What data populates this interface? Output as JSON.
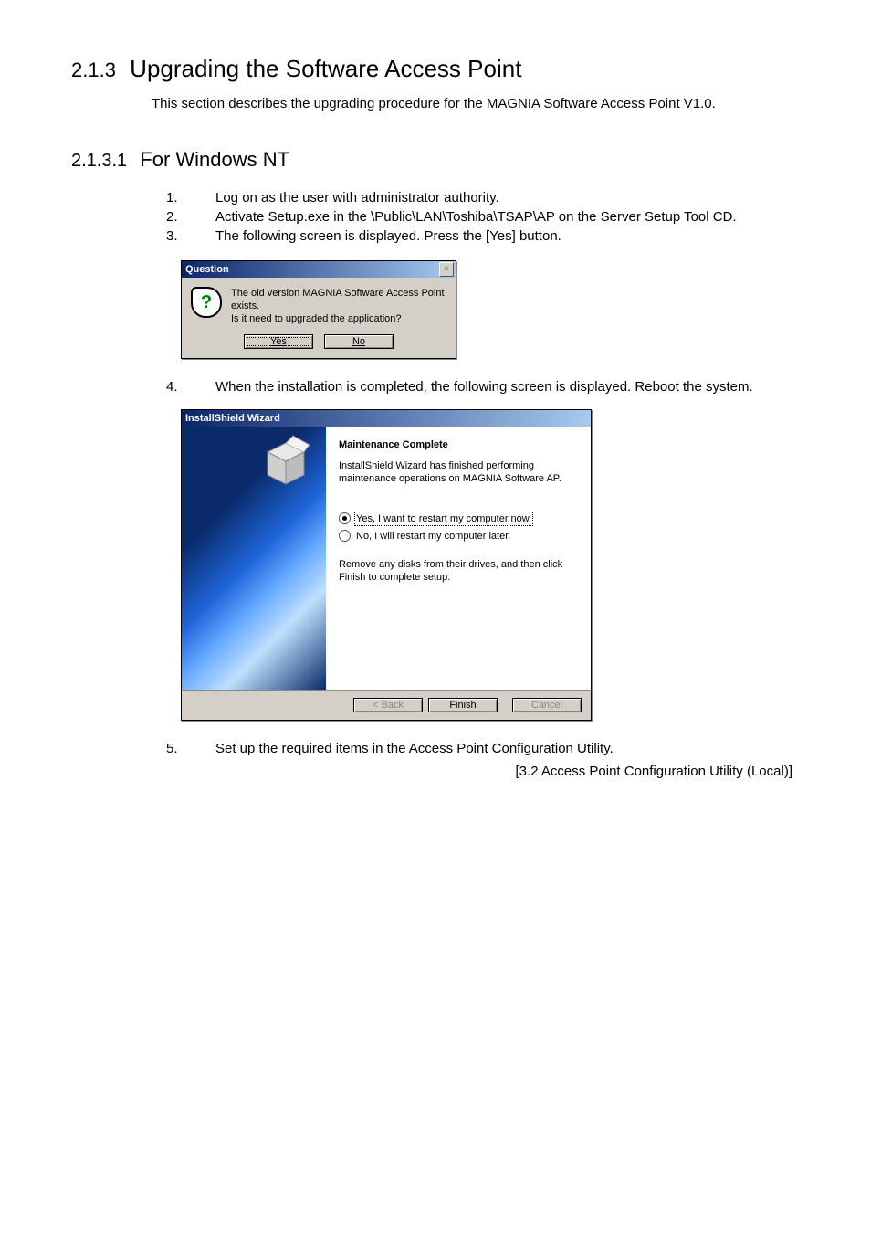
{
  "section": {
    "number": "2.1.3",
    "title": "Upgrading the Software Access Point",
    "intro": "This section describes the upgrading procedure for the MAGNIA Software Access Point V1.0."
  },
  "subsection": {
    "number": "2.1.3.1",
    "title": "For Windows NT"
  },
  "steps": {
    "s1": {
      "num": "1.",
      "text": "Log on as the user with administrator authority."
    },
    "s2": {
      "num": "2.",
      "text": "Activate Setup.exe in the \\Public\\LAN\\Toshiba\\TSAP\\AP on the Server Setup Tool CD."
    },
    "s3": {
      "num": "3.",
      "text": "The following screen is displayed.   Press the [Yes] button."
    },
    "s4": {
      "num": "4.",
      "text": "When the installation is completed, the following screen is displayed.  Reboot the system."
    },
    "s5": {
      "num": "5.",
      "text": "Set up the required items in the Access Point Configuration Utility."
    }
  },
  "xref": "[3.2 Access Point Configuration Utility (Local)]",
  "dialog_q": {
    "title": "Question",
    "line1": "The old version MAGNIA Software Access Point exists.",
    "line2": "Is it need to upgraded the application?",
    "yes": "Yes",
    "no": "No"
  },
  "dialog_w": {
    "title": "InstallShield Wizard",
    "heading": "Maintenance Complete",
    "para": "InstallShield Wizard has finished performing maintenance operations on MAGNIA Software AP.",
    "opt1": "Yes, I want to restart my computer now.",
    "opt2": "No, I will restart my computer later.",
    "note": "Remove any disks from their drives, and then click Finish to complete setup.",
    "back": "< Back",
    "finish": "Finish",
    "cancel": "Cancel"
  }
}
